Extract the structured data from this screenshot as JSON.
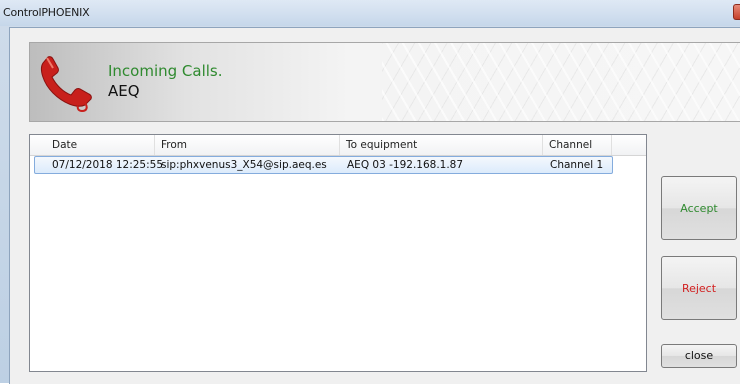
{
  "window": {
    "title": "ControlPHOENIX"
  },
  "banner": {
    "title": "Incoming Calls.",
    "subtitle": "AEQ",
    "icon": "phone-icon",
    "title_color": "#2f8a2f"
  },
  "table": {
    "columns": [
      "Date",
      "From",
      "To equipment",
      "Channel"
    ],
    "rows": [
      {
        "date": "07/12/2018 12:25:55",
        "from": "sip:phxvenus3_X54@sip.aeq.es",
        "to": "AEQ 03 -192.168.1.87",
        "channel": "Channel 1"
      }
    ]
  },
  "buttons": {
    "accept": "Accept",
    "reject": "Reject",
    "close": "close"
  },
  "colors": {
    "accept": "#2f8a2f",
    "reject": "#d22020",
    "selection": "#cce4fb"
  }
}
